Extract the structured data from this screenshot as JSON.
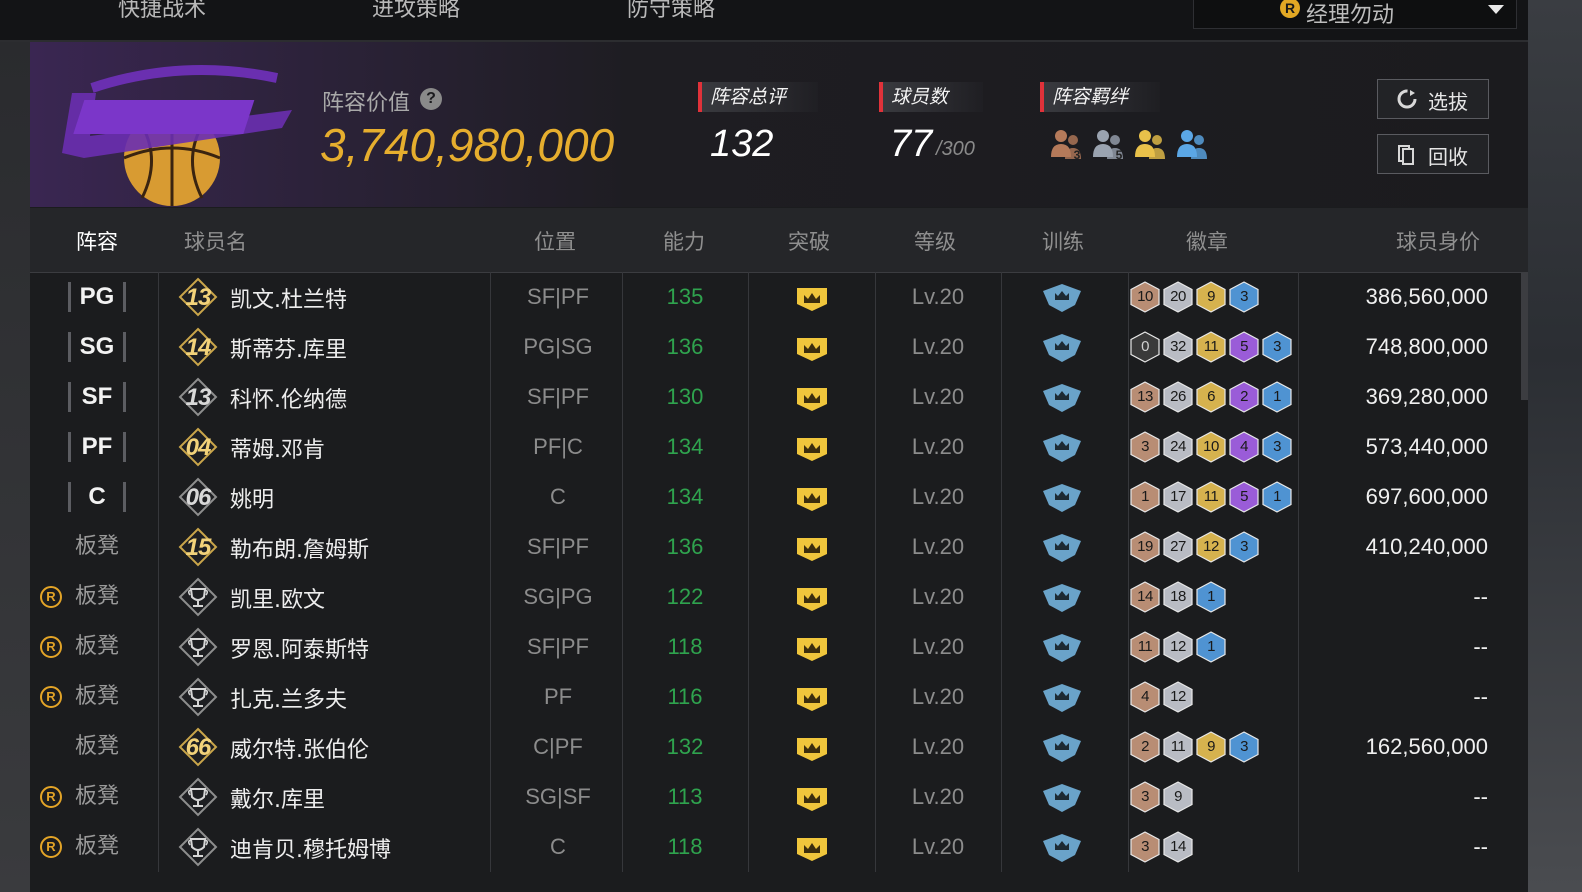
{
  "topnav": {
    "tabs": [
      "快捷战术",
      "进攻策略",
      "防守策略"
    ],
    "manager_label": "经理勿动"
  },
  "header": {
    "lineup_value_label": "阵容价值",
    "lineup_value": "3,740,980,000",
    "overall_label": "阵容总评",
    "overall_value": "132",
    "players_label": "球员数",
    "players_value": "77",
    "players_max": "/300",
    "bonds_label": "阵容羁绊",
    "bond_icons": [
      {
        "name": "bond-icon-bronze",
        "num": "3",
        "color": "#b57a5a"
      },
      {
        "name": "bond-icon-silver",
        "num": "5",
        "color": "#9aa3b0"
      },
      {
        "name": "bond-icon-gold",
        "num": "",
        "color": "#e9c14a"
      },
      {
        "name": "bond-icon-blue",
        "num": "",
        "color": "#5ba7e6"
      }
    ],
    "draft_button": "选拔",
    "recycle_button": "回收"
  },
  "columns": {
    "lineup": "阵容",
    "name": "球员名",
    "position": "位置",
    "ability": "能力",
    "breakthrough": "突破",
    "level": "等级",
    "training": "训练",
    "badges": "徽章",
    "value": "球员身价"
  },
  "badge_colors": {
    "bronze": "#b88d74",
    "silver": "#b9bcc4",
    "gold": "#d6b24e",
    "purple": "#9a5cd8",
    "blue": "#4f93d2",
    "black": "#3a3a3a"
  },
  "rows": [
    {
      "slot": "PG",
      "bench": false,
      "r": false,
      "jersey": "13",
      "jersey_style": "gold",
      "name": "凯文.杜兰特",
      "pos": "SF|PF",
      "ability": "135",
      "level": "Lv.20",
      "badges": [
        {
          "n": "10",
          "c": "bronze"
        },
        {
          "n": "20",
          "c": "silver"
        },
        {
          "n": "9",
          "c": "gold"
        },
        {
          "n": "3",
          "c": "blue"
        }
      ],
      "price": "386,560,000"
    },
    {
      "slot": "SG",
      "bench": false,
      "r": false,
      "jersey": "14",
      "jersey_style": "gold",
      "name": "斯蒂芬.库里",
      "pos": "PG|SG",
      "ability": "136",
      "level": "Lv.20",
      "badges": [
        {
          "n": "0",
          "c": "black"
        },
        {
          "n": "32",
          "c": "silver"
        },
        {
          "n": "11",
          "c": "gold"
        },
        {
          "n": "5",
          "c": "purple"
        },
        {
          "n": "3",
          "c": "blue"
        }
      ],
      "price": "748,800,000"
    },
    {
      "slot": "SF",
      "bench": false,
      "r": false,
      "jersey": "13",
      "jersey_style": "silver",
      "name": "科怀.伦纳德",
      "pos": "SF|PF",
      "ability": "130",
      "level": "Lv.20",
      "badges": [
        {
          "n": "13",
          "c": "bronze"
        },
        {
          "n": "26",
          "c": "silver"
        },
        {
          "n": "6",
          "c": "gold"
        },
        {
          "n": "2",
          "c": "purple"
        },
        {
          "n": "1",
          "c": "blue"
        }
      ],
      "price": "369,280,000"
    },
    {
      "slot": "PF",
      "bench": false,
      "r": false,
      "jersey": "04",
      "jersey_style": "gold",
      "name": "蒂姆.邓肯",
      "pos": "PF|C",
      "ability": "134",
      "level": "Lv.20",
      "badges": [
        {
          "n": "3",
          "c": "bronze"
        },
        {
          "n": "24",
          "c": "silver"
        },
        {
          "n": "10",
          "c": "gold"
        },
        {
          "n": "4",
          "c": "purple"
        },
        {
          "n": "3",
          "c": "blue"
        }
      ],
      "price": "573,440,000"
    },
    {
      "slot": "C",
      "bench": false,
      "r": false,
      "jersey": "06",
      "jersey_style": "silver",
      "name": "姚明",
      "pos": "C",
      "ability": "134",
      "level": "Lv.20",
      "badges": [
        {
          "n": "1",
          "c": "bronze"
        },
        {
          "n": "17",
          "c": "silver"
        },
        {
          "n": "11",
          "c": "gold"
        },
        {
          "n": "5",
          "c": "purple"
        },
        {
          "n": "1",
          "c": "blue"
        }
      ],
      "price": "697,600,000"
    },
    {
      "slot": "板凳",
      "bench": true,
      "r": false,
      "jersey": "15",
      "jersey_style": "gold",
      "name": "勒布朗.詹姆斯",
      "pos": "SF|PF",
      "ability": "136",
      "level": "Lv.20",
      "badges": [
        {
          "n": "19",
          "c": "bronze"
        },
        {
          "n": "27",
          "c": "silver"
        },
        {
          "n": "12",
          "c": "gold"
        },
        {
          "n": "3",
          "c": "blue"
        }
      ],
      "price": "410,240,000"
    },
    {
      "slot": "板凳",
      "bench": true,
      "r": true,
      "jersey": "",
      "jersey_style": "trophy",
      "name": "凯里.欧文",
      "pos": "SG|PG",
      "ability": "122",
      "level": "Lv.20",
      "badges": [
        {
          "n": "14",
          "c": "bronze"
        },
        {
          "n": "18",
          "c": "silver"
        },
        {
          "n": "1",
          "c": "blue"
        }
      ],
      "price": "--"
    },
    {
      "slot": "板凳",
      "bench": true,
      "r": true,
      "jersey": "",
      "jersey_style": "trophy",
      "name": "罗恩.阿泰斯特",
      "pos": "SF|PF",
      "ability": "118",
      "level": "Lv.20",
      "badges": [
        {
          "n": "11",
          "c": "bronze"
        },
        {
          "n": "12",
          "c": "silver"
        },
        {
          "n": "1",
          "c": "blue"
        }
      ],
      "price": "--"
    },
    {
      "slot": "板凳",
      "bench": true,
      "r": true,
      "jersey": "",
      "jersey_style": "trophy",
      "name": "扎克.兰多夫",
      "pos": "PF",
      "ability": "116",
      "level": "Lv.20",
      "badges": [
        {
          "n": "4",
          "c": "bronze"
        },
        {
          "n": "12",
          "c": "silver"
        }
      ],
      "price": "--"
    },
    {
      "slot": "板凳",
      "bench": true,
      "r": false,
      "jersey": "66",
      "jersey_style": "gold",
      "name": "威尔特.张伯伦",
      "pos": "C|PF",
      "ability": "132",
      "level": "Lv.20",
      "badges": [
        {
          "n": "2",
          "c": "bronze"
        },
        {
          "n": "11",
          "c": "silver"
        },
        {
          "n": "9",
          "c": "gold"
        },
        {
          "n": "3",
          "c": "blue"
        }
      ],
      "price": "162,560,000"
    },
    {
      "slot": "板凳",
      "bench": true,
      "r": true,
      "jersey": "",
      "jersey_style": "trophy",
      "name": "戴尔.库里",
      "pos": "SG|SF",
      "ability": "113",
      "level": "Lv.20",
      "badges": [
        {
          "n": "3",
          "c": "bronze"
        },
        {
          "n": "9",
          "c": "silver"
        }
      ],
      "price": "--"
    },
    {
      "slot": "板凳",
      "bench": true,
      "r": true,
      "jersey": "",
      "jersey_style": "trophy",
      "name": "迪肯贝.穆托姆博",
      "pos": "C",
      "ability": "118",
      "level": "Lv.20",
      "badges": [
        {
          "n": "3",
          "c": "bronze"
        },
        {
          "n": "14",
          "c": "silver"
        }
      ],
      "price": "--"
    }
  ]
}
